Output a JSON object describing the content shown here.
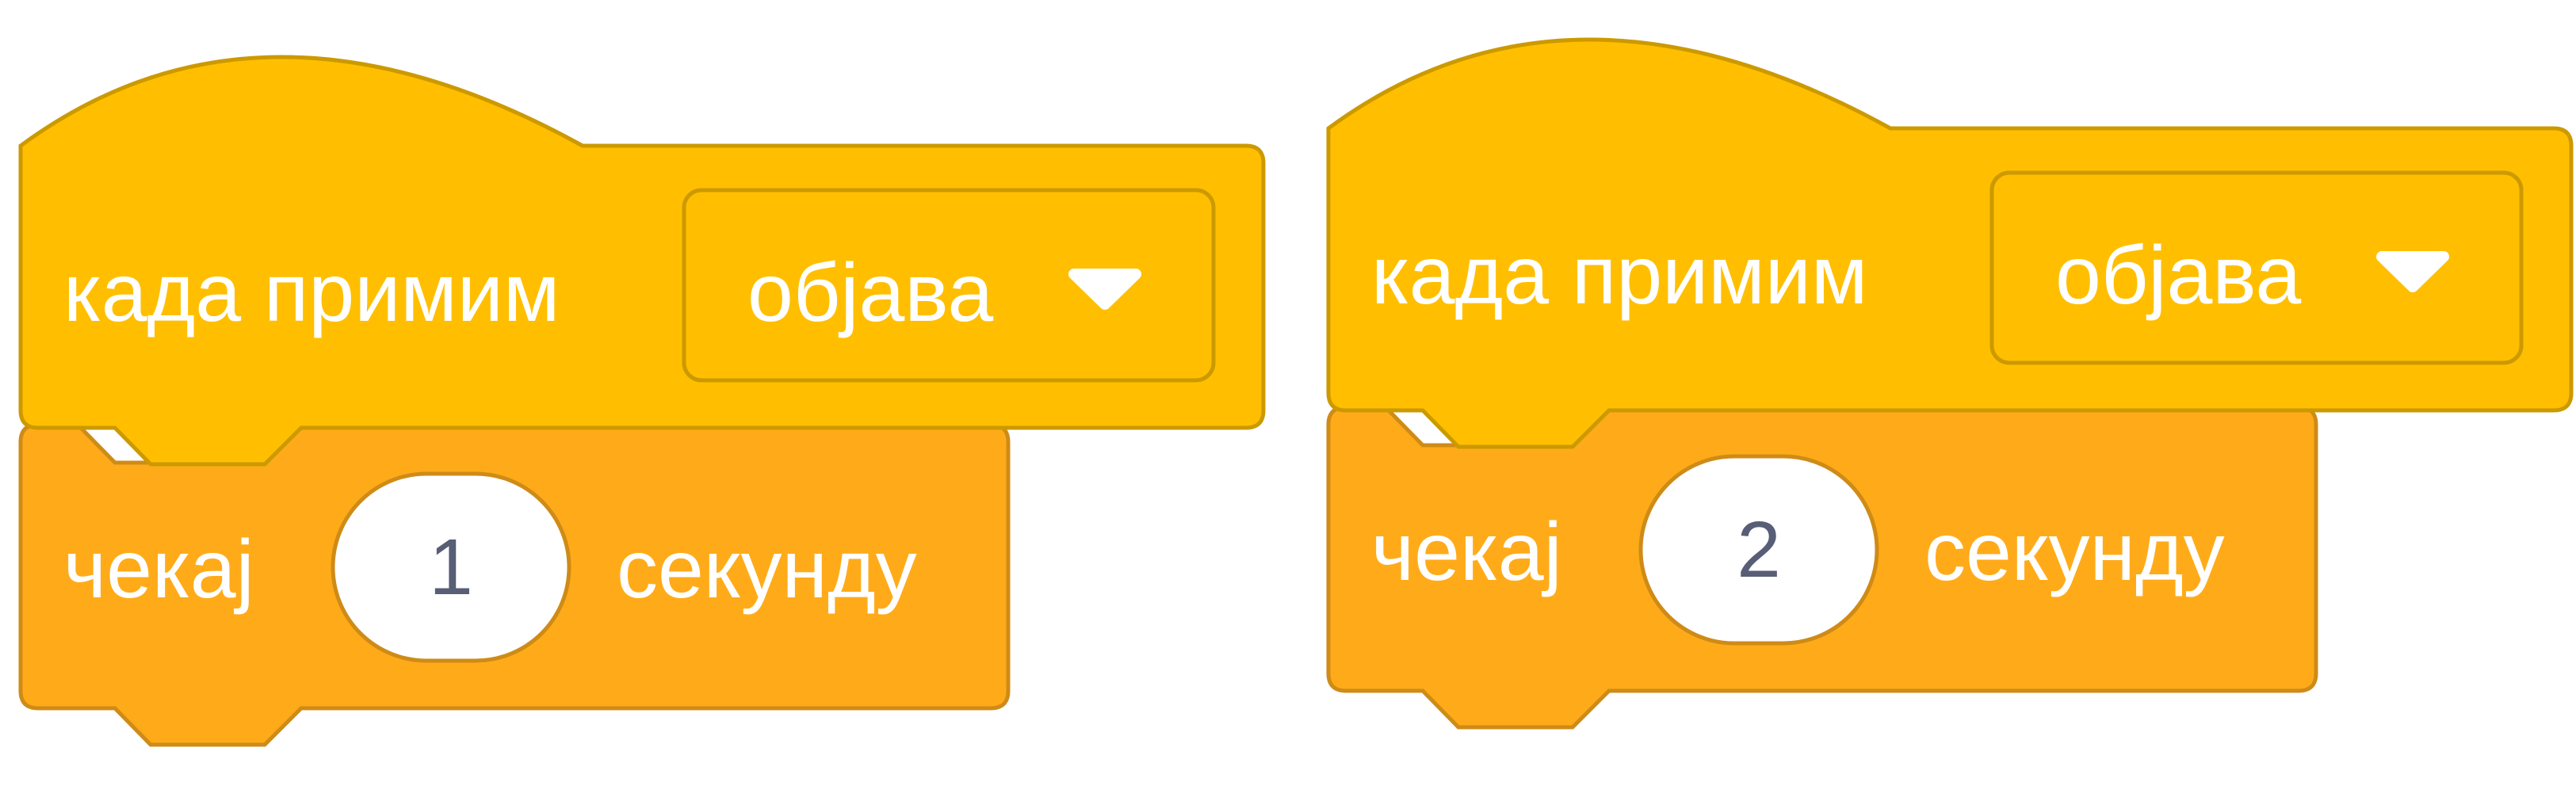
{
  "colors": {
    "event_block": "#ffbf00",
    "event_block_border": "#cc9900",
    "control_block": "#ffab19",
    "control_block_border": "#cf8b17",
    "number_input_bg": "#ffffff",
    "number_text": "#575e75",
    "block_text": "#ffffff"
  },
  "scripts": [
    {
      "hat_block": {
        "label": "када примим",
        "dropdown_value": "објава",
        "dropdown_icon": "triangle-down-icon"
      },
      "wait_block": {
        "label_before": "чекај",
        "seconds": "1",
        "label_after": "секунду"
      }
    },
    {
      "hat_block": {
        "label": "када примим",
        "dropdown_value": "објава",
        "dropdown_icon": "triangle-down-icon"
      },
      "wait_block": {
        "label_before": "чекај",
        "seconds": "2",
        "label_after": "секунду"
      }
    }
  ]
}
